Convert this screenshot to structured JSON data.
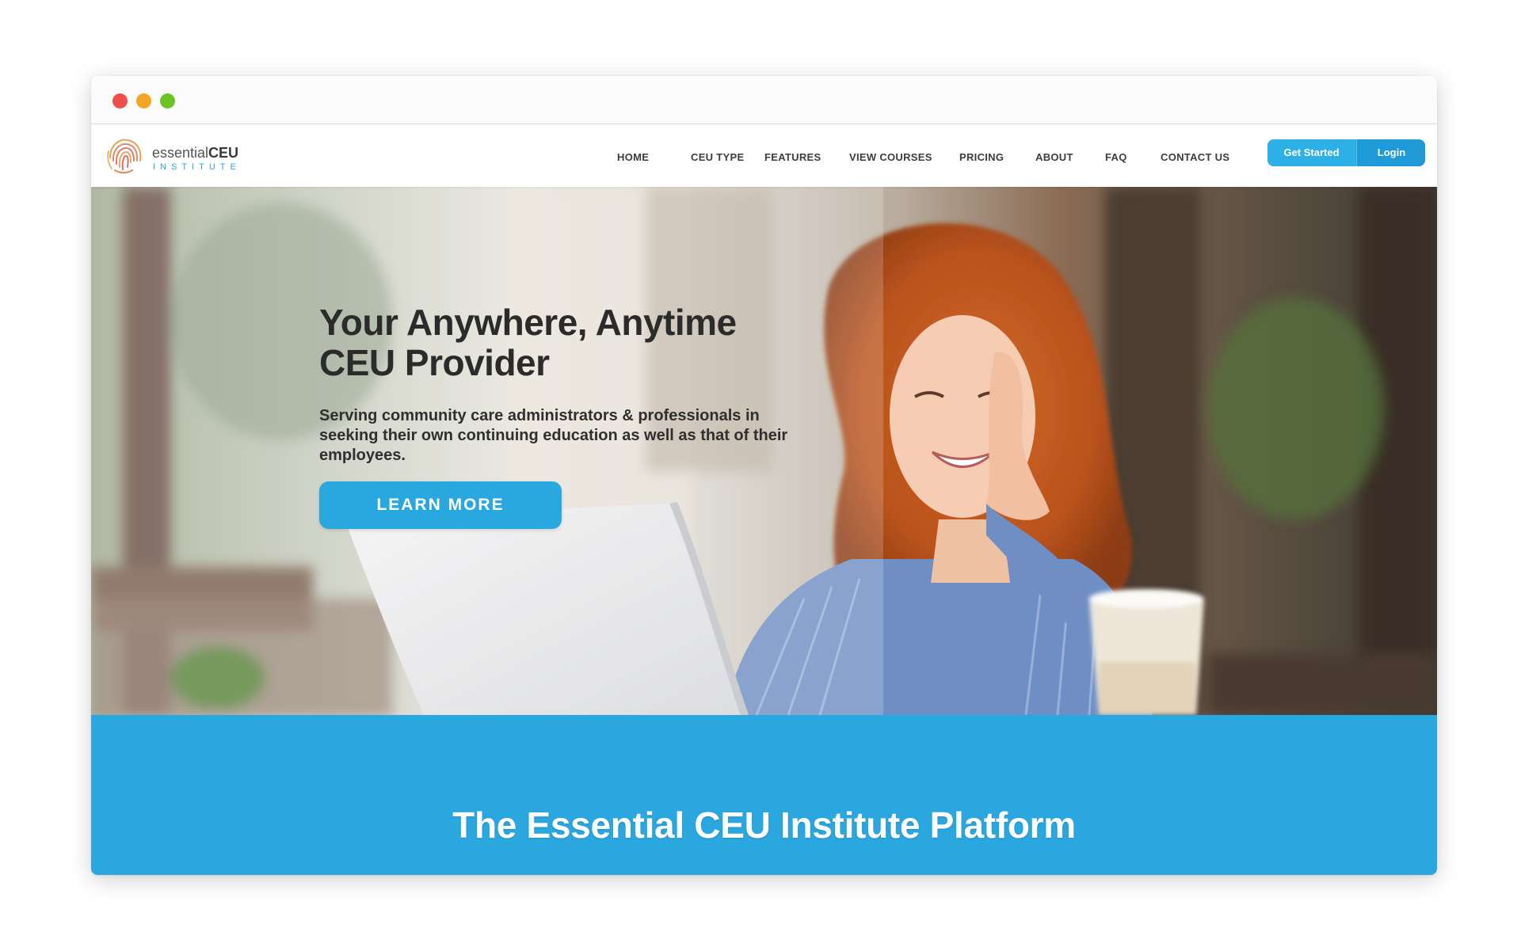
{
  "logo": {
    "text_light": "essential",
    "text_bold": "CEU",
    "subtitle": "INSTITUTE"
  },
  "nav": {
    "items": [
      {
        "label": "HOME"
      },
      {
        "label": "CEU TYPE"
      },
      {
        "label": "FEATURES"
      },
      {
        "label": "VIEW COURSES"
      },
      {
        "label": "PRICING"
      },
      {
        "label": "ABOUT"
      },
      {
        "label": "FAQ"
      },
      {
        "label": "CONTACT US"
      }
    ],
    "get_started_label": "Get Started",
    "login_label": "Login"
  },
  "hero": {
    "title_line1": "Your Anywhere, Anytime",
    "title_line2": "CEU Provider",
    "subtitle": "Serving community care administrators & professionals in seeking their own continuing education as well as that of their employees.",
    "cta_label": "LEARN MORE"
  },
  "band": {
    "title": "The Essential CEU Institute Platform"
  },
  "colors": {
    "brand_blue": "#29a8e0",
    "text_dark": "#2b2b2b",
    "close_dot": "#ee4d4a",
    "minimize_dot": "#f5a524",
    "maximize_dot": "#6cc324"
  }
}
